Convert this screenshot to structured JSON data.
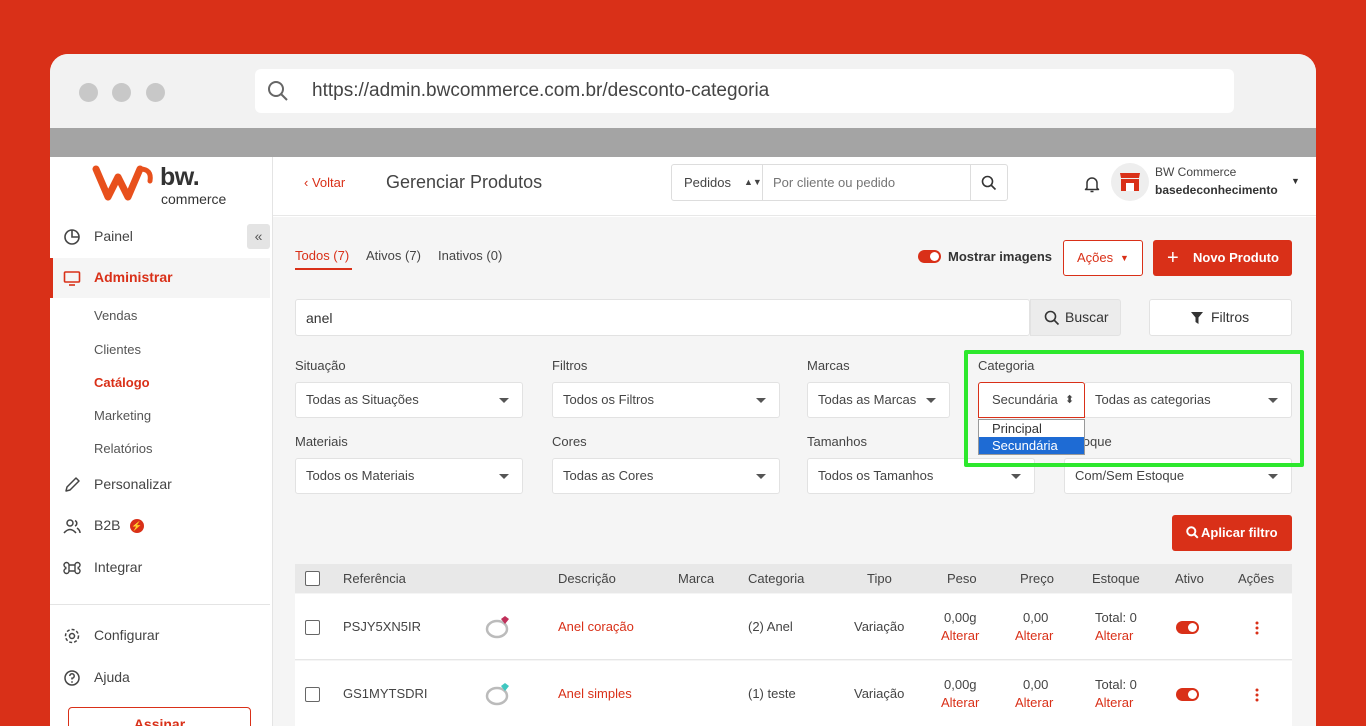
{
  "browser": {
    "url": "https://admin.bwcommerce.com.br/desconto-categoria"
  },
  "logo": {
    "brand": "bw.",
    "sub": "commerce"
  },
  "sidebar": {
    "collapse_label": "«",
    "items": [
      {
        "label": "Painel",
        "icon": "pie-chart-icon"
      },
      {
        "label": "Administrar",
        "icon": "monitor-icon"
      },
      {
        "label": "Personalizar",
        "icon": "pencil-icon"
      },
      {
        "label": "B2B",
        "icon": "users-icon"
      },
      {
        "label": "Integrar",
        "icon": "command-icon"
      },
      {
        "label": "Configurar",
        "icon": "gear-icon"
      },
      {
        "label": "Ajuda",
        "icon": "help-icon"
      }
    ],
    "subitems": [
      "Vendas",
      "Clientes",
      "Catálogo",
      "Marketing",
      "Relatórios"
    ],
    "assinar_label": "Assinar"
  },
  "header": {
    "back_label": "Voltar",
    "title": "Gerenciar Produtos",
    "search_type": "Pedidos",
    "search_placeholder": "Por cliente ou pedido",
    "store_name": "BW Commerce",
    "store_user": "basedeconhecimento"
  },
  "toolbar": {
    "tabs": [
      "Todos (7)",
      "Ativos (7)",
      "Inativos (0)"
    ],
    "show_images_label": "Mostrar imagens",
    "acoes_label": "Ações",
    "novo_label": "Novo Produto"
  },
  "search": {
    "value": "anel",
    "buscar_label": "Buscar",
    "filtros_label": "Filtros"
  },
  "filters": {
    "situacao": {
      "label": "Situação",
      "value": "Todas as Situações"
    },
    "filtros": {
      "label": "Filtros",
      "value": "Todos os Filtros"
    },
    "marcas": {
      "label": "Marcas",
      "value": "Todas as Marcas"
    },
    "categoria": {
      "label": "Categoria",
      "type_value": "Secundária",
      "value": "Todas as categorias",
      "options": [
        "Principal",
        "Secundária"
      ]
    },
    "materiais": {
      "label": "Materiais",
      "value": "Todos os Materiais"
    },
    "cores": {
      "label": "Cores",
      "value": "Todas as Cores"
    },
    "tamanhos": {
      "label": "Tamanhos",
      "value": "Todos os Tamanhos"
    },
    "estoque": {
      "label": "Estoque",
      "value": "Com/Sem Estoque"
    },
    "apply_label": "Aplicar filtro"
  },
  "table": {
    "columns": [
      "Referência",
      "Descrição",
      "Marca",
      "Categoria",
      "Tipo",
      "Peso",
      "Preço",
      "Estoque",
      "Ativo",
      "Ações"
    ],
    "rows": [
      {
        "ref": "PSJY5XN5IR",
        "desc": "Anel coração",
        "marca": "",
        "categoria": "(2) Anel",
        "tipo": "Variação",
        "peso": "0,00g",
        "preco": "0,00",
        "estoque": "Total: 0",
        "alterar": "Alterar",
        "gem_color": "#c0305a"
      },
      {
        "ref": "GS1MYTSDRI",
        "desc": "Anel simples",
        "marca": "",
        "categoria": "(1) teste",
        "tipo": "Variação",
        "peso": "0,00g",
        "preco": "0,00",
        "estoque": "Total: 0",
        "alterar": "Alterar",
        "gem_color": "#3fc7c0"
      }
    ]
  }
}
